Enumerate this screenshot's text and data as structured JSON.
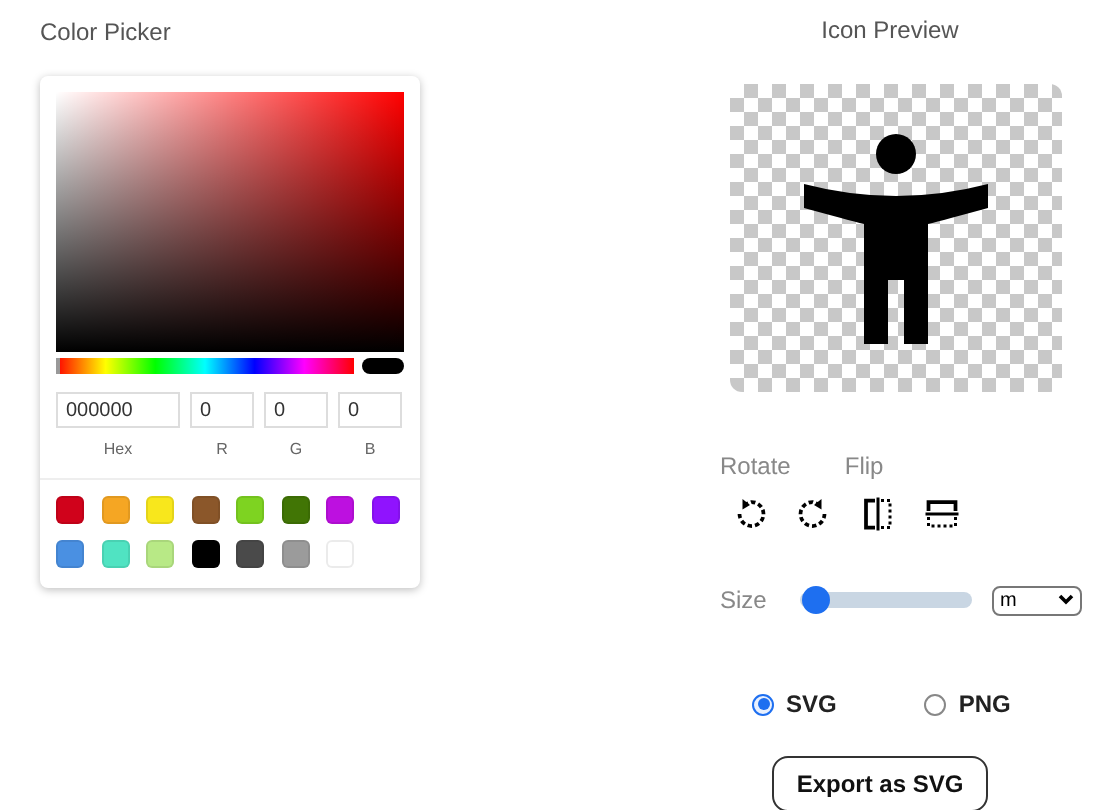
{
  "picker": {
    "title": "Color Picker",
    "hex": "000000",
    "hue": {
      "level": 0
    },
    "r": "0",
    "g": "0",
    "b": "0",
    "labels": [
      "Hex",
      "R",
      "G",
      "B"
    ],
    "swatches": [
      {
        "color": "#d0021b"
      },
      {
        "color": "#f5a623"
      },
      {
        "color": "#f8e71c"
      },
      {
        "color": "#8b572a"
      },
      {
        "color": "#7ed321"
      },
      {
        "color": "#417505"
      },
      {
        "color": "#bd10e0"
      },
      {
        "color": "#9013fe"
      },
      {
        "color": "#4a90e2"
      },
      {
        "color": "#50e3c2"
      },
      {
        "color": "#b8e986"
      },
      {
        "color": "#000000"
      },
      {
        "color": "#4a4a4a"
      },
      {
        "color": "#9b9b9b"
      },
      {
        "color": "#ffffff"
      }
    ]
  },
  "preview": {
    "title": "Icon Preview",
    "rotate_label": "Rotate",
    "flip_label": "Flip",
    "size_label": "Size",
    "size": {
      "level": 0.04
    },
    "unit": "m",
    "formats": [
      {
        "label": "SVG",
        "selected": true
      },
      {
        "label": "PNG",
        "selected": false
      }
    ],
    "export_button": "Export as SVG"
  }
}
